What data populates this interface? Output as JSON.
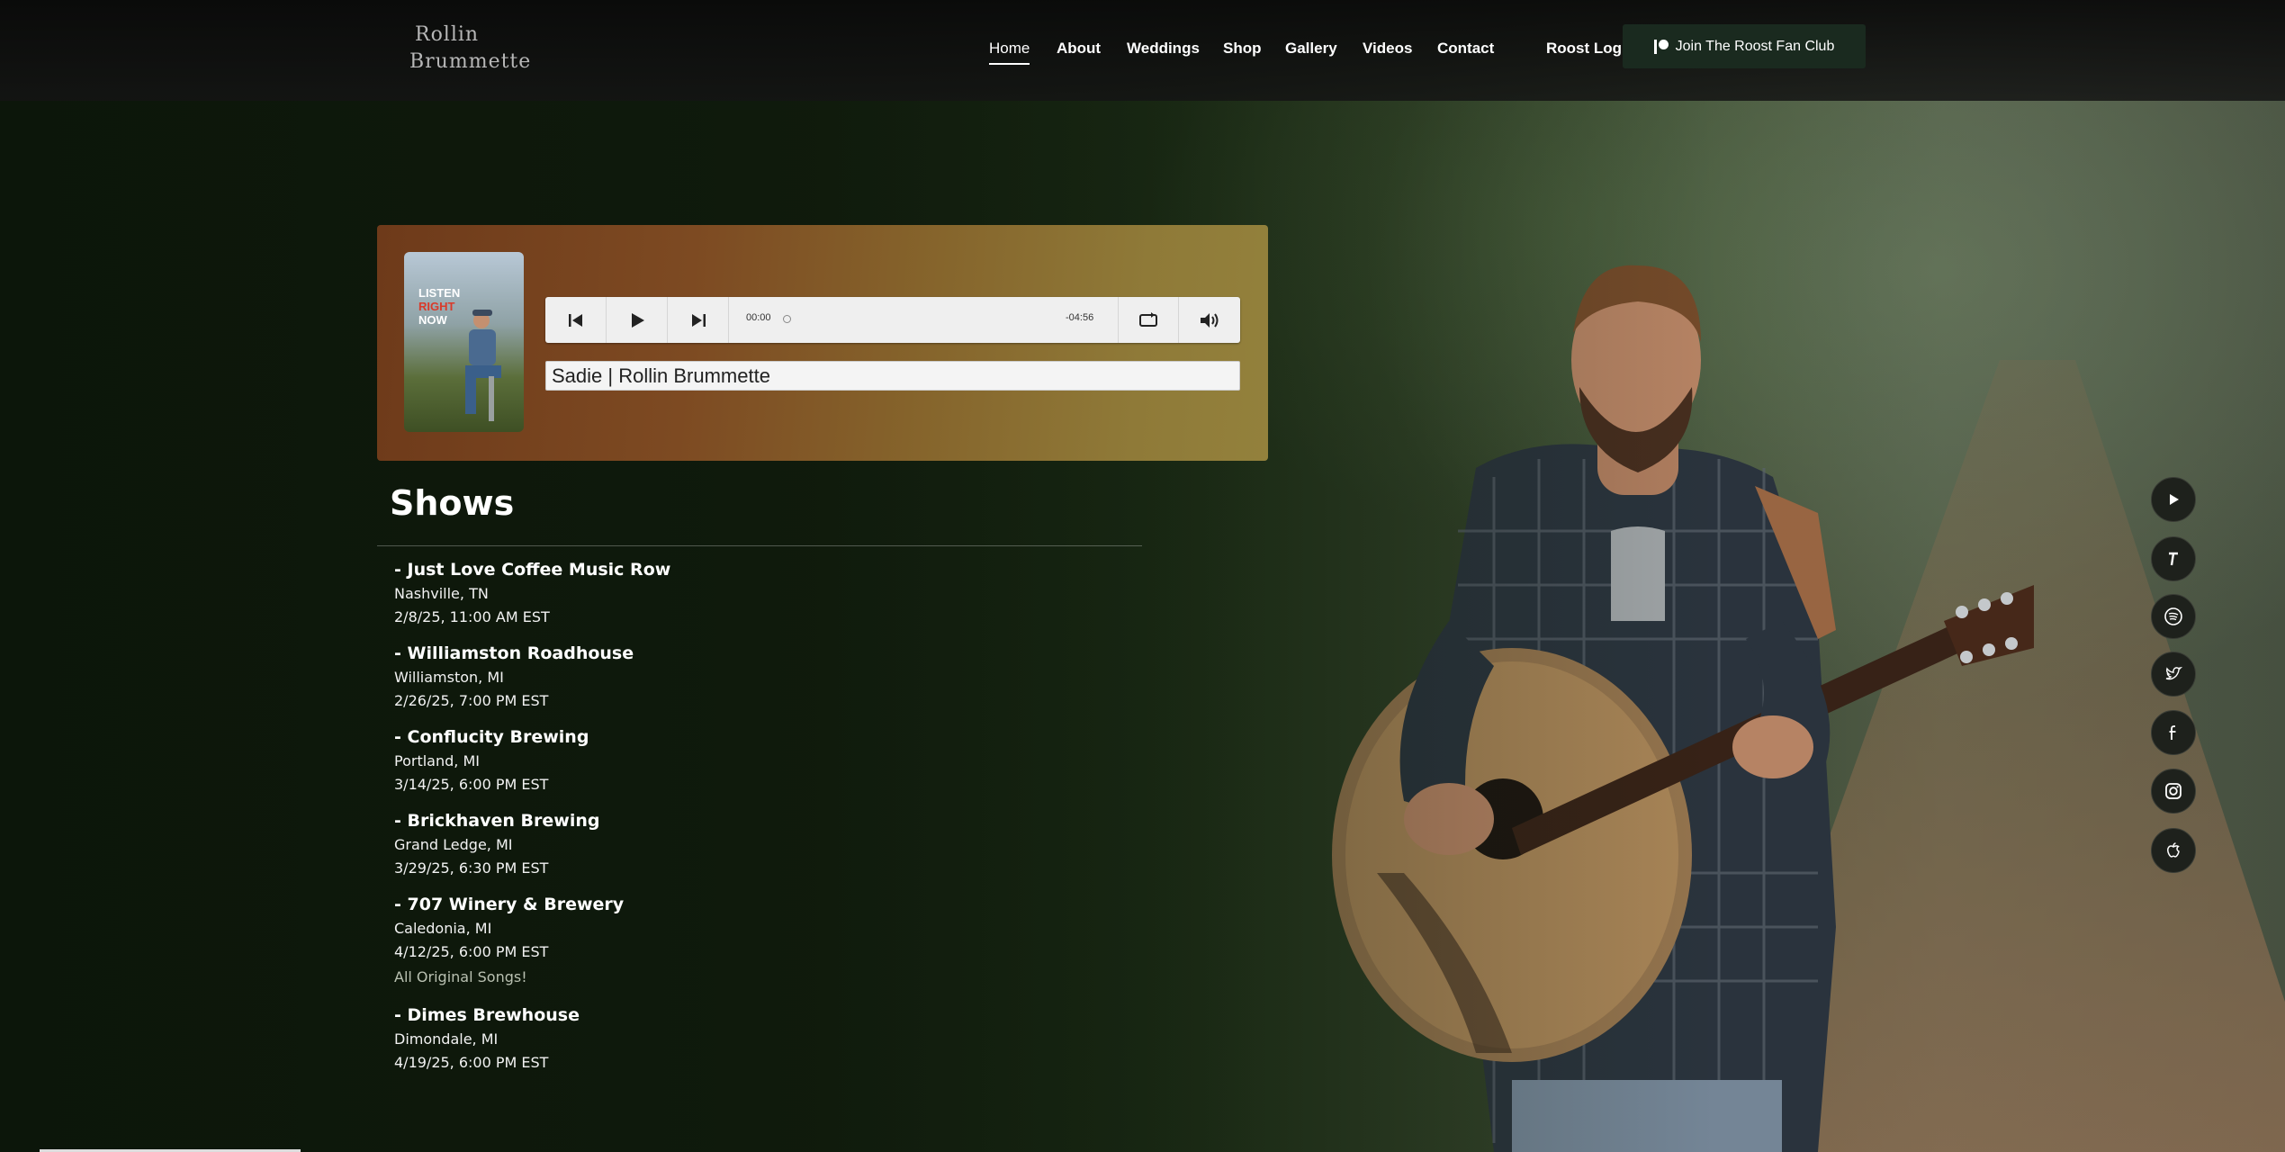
{
  "brand": {
    "logo_line1": "Rollin",
    "logo_line2": "Brummette"
  },
  "nav": {
    "items": [
      {
        "label": "Home",
        "active": true
      },
      {
        "label": "About"
      },
      {
        "label": "Weddings"
      },
      {
        "label": "Shop"
      },
      {
        "label": "Gallery"
      },
      {
        "label": "Videos"
      },
      {
        "label": "Contact"
      },
      {
        "label": "Roost Login"
      }
    ],
    "cta_label": "Join The Roost Fan Club",
    "cta_icon": "patreon-icon"
  },
  "player": {
    "cover_text": [
      "LISTEN",
      "RIGHT",
      "NOW"
    ],
    "current_time": "00:00",
    "remaining_time": "-04:56",
    "track_title": "Sadie | Rollin Brummette",
    "controls": [
      "previous-icon",
      "play-icon",
      "next-icon",
      "repeat-icon",
      "volume-icon"
    ]
  },
  "shows": {
    "title": "Shows",
    "items": [
      {
        "venue": "- Just Love Coffee Music Row",
        "city": "Nashville, TN",
        "date": "2/8/25, 11:00 AM EST"
      },
      {
        "venue": "- Williamston Roadhouse",
        "city": "Williamston, MI",
        "date": "2/26/25, 7:00 PM EST"
      },
      {
        "venue": "- Conflucity Brewing",
        "city": "Portland, MI",
        "date": "3/14/25, 6:00 PM EST"
      },
      {
        "venue": "- Brickhaven Brewing",
        "city": "Grand Ledge, MI",
        "date": "3/29/25, 6:30 PM EST"
      },
      {
        "venue": "- 707 Winery & Brewery",
        "city": "Caledonia, MI",
        "date": "4/12/25, 6:00 PM EST",
        "note": "All Original Songs!"
      },
      {
        "venue": "- Dimes Brewhouse",
        "city": "Dimondale, MI",
        "date": "4/19/25, 6:00 PM EST"
      }
    ]
  },
  "social": [
    "youtube-icon",
    "tiktok-icon",
    "spotify-icon",
    "twitter-icon",
    "facebook-icon",
    "instagram-icon",
    "apple-music-icon"
  ],
  "colors": {
    "header_bg": "#141414",
    "cta_bg": "#1a2a1f",
    "player_left": "#6e3a1a",
    "player_right": "#93813c"
  }
}
